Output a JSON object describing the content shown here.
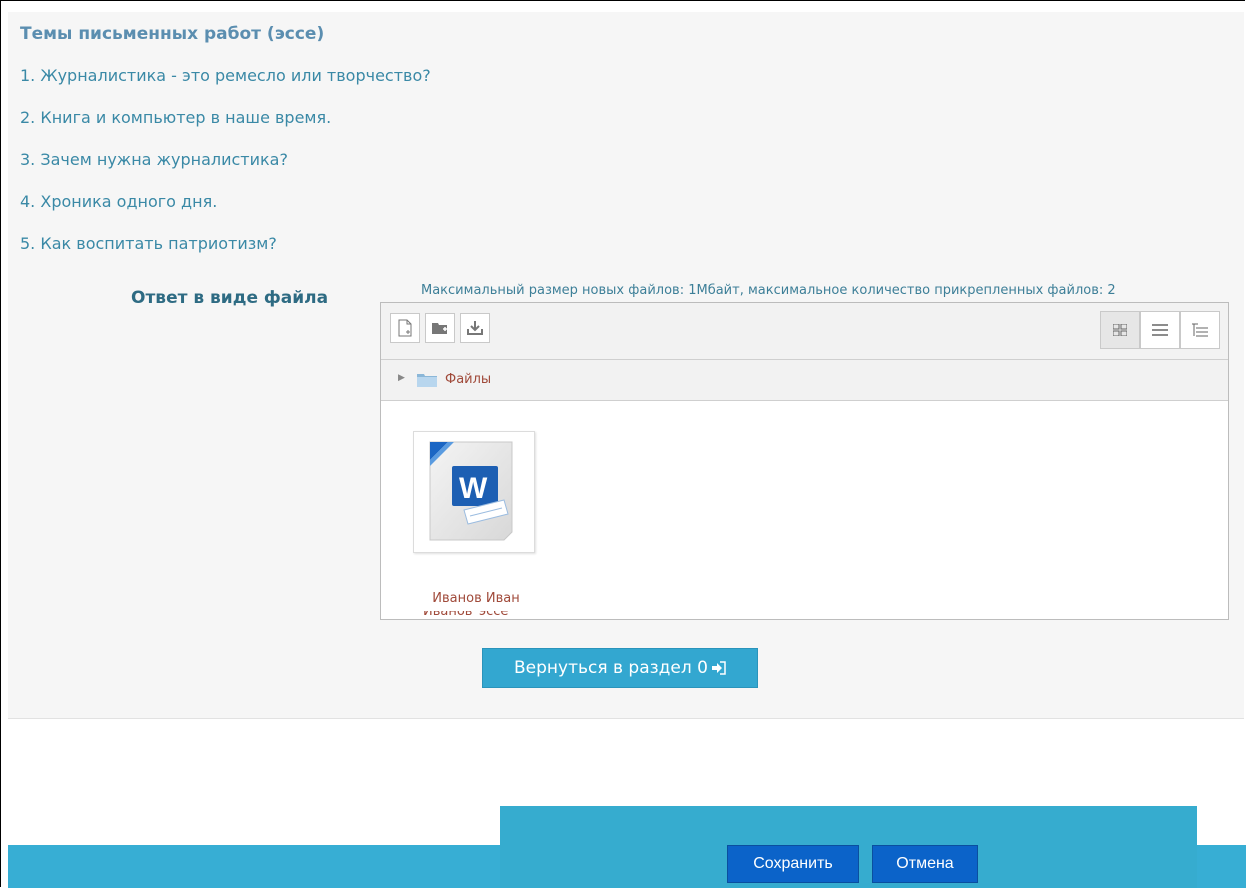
{
  "section": {
    "title": "Темы письменных работ (эссе)",
    "topics": [
      "1. Журналистика - это ремесло или творчество?",
      "2. Книга и компьютер в наше время.",
      "3. Зачем нужна журналистика?",
      "4. Хроника одного дня.",
      "5. Как воспитать патриотизм?"
    ]
  },
  "answer": {
    "label": "Ответ в виде файла",
    "limits": "Максимальный размер новых файлов: 1Мбайт, максимальное количество прикрепленных файлов: 2"
  },
  "filemanager": {
    "path_label": "Файлы",
    "file": {
      "name_line1": "Иванов Иван",
      "name_line2": "Иванов_эссе"
    },
    "icons": {
      "add_file": "add-file-icon",
      "create_folder": "create-folder-icon",
      "download": "download-icon",
      "view_icons": "grid-view-icon",
      "view_list": "list-view-icon",
      "view_tree": "tree-view-icon"
    }
  },
  "actions": {
    "return_label": "Вернуться в раздел 0",
    "save_label": "Сохранить",
    "cancel_label": "Отмена"
  },
  "colors": {
    "accent_blue": "#33a7d0",
    "primary_button": "#0b63c9",
    "link_red": "#a04a3a",
    "topic_text": "#3a89a6"
  }
}
